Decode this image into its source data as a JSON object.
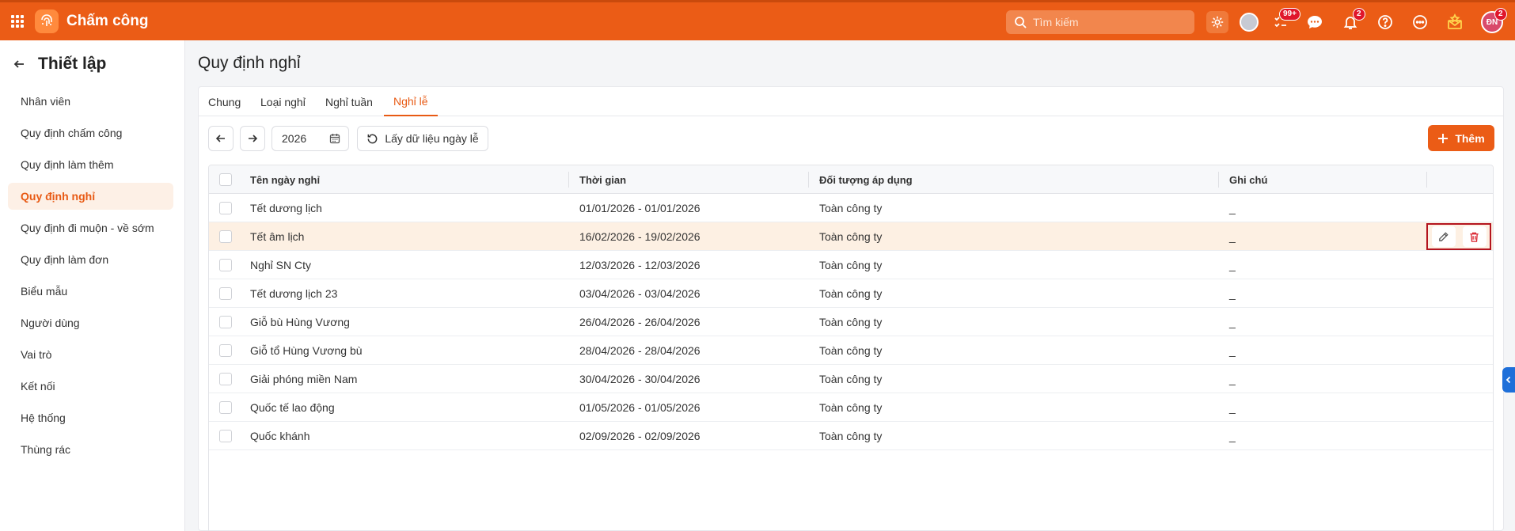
{
  "app": {
    "title": "Chấm công"
  },
  "topbar": {
    "search_placeholder": "Tìm kiếm",
    "tasks_badge": "99+",
    "notifications_badge": "2",
    "avatar_badge": "2",
    "avatar_initials": "ĐN"
  },
  "sidebar": {
    "title": "Thiết lập",
    "items": [
      {
        "label": "Nhân viên"
      },
      {
        "label": "Quy định chấm công"
      },
      {
        "label": "Quy định làm thêm"
      },
      {
        "label": "Quy định nghỉ"
      },
      {
        "label": "Quy định đi muộn - về sớm"
      },
      {
        "label": "Quy định làm đơn"
      },
      {
        "label": "Biểu mẫu"
      },
      {
        "label": "Người dùng"
      },
      {
        "label": "Vai trò"
      },
      {
        "label": "Kết nối"
      },
      {
        "label": "Hệ thống"
      },
      {
        "label": "Thùng rác"
      }
    ],
    "active_item": "Quy định nghỉ"
  },
  "main": {
    "title": "Quy định nghỉ",
    "tabs": [
      {
        "label": "Chung"
      },
      {
        "label": "Loại nghỉ"
      },
      {
        "label": "Nghỉ tuần"
      },
      {
        "label": "Nghỉ lễ"
      }
    ],
    "active_tab": "Nghỉ lễ",
    "toolbar": {
      "year_value": "2026",
      "fetch_label": "Lấy dữ liệu ngày lễ",
      "add_label": "Thêm"
    },
    "table": {
      "columns": [
        "Tên ngày nghỉ",
        "Thời gian",
        "Đối tượng áp dụng",
        "Ghi chú"
      ],
      "rows": [
        {
          "name": "Tết dương lịch",
          "time": "01/01/2026 - 01/01/2026",
          "target": "Toàn công ty",
          "note": "_"
        },
        {
          "name": "Tết âm lịch",
          "time": "16/02/2026 - 19/02/2026",
          "target": "Toàn công ty",
          "note": "_"
        },
        {
          "name": "Nghỉ SN Cty",
          "time": "12/03/2026 - 12/03/2026",
          "target": "Toàn công ty",
          "note": "_"
        },
        {
          "name": "Tết dương lịch 23",
          "time": "03/04/2026 - 03/04/2026",
          "target": "Toàn công ty",
          "note": "_"
        },
        {
          "name": "Giỗ bù Hùng Vương",
          "time": "26/04/2026 - 26/04/2026",
          "target": "Toàn công ty",
          "note": "_"
        },
        {
          "name": "Giỗ tổ Hùng Vương bù",
          "time": "28/04/2026 - 28/04/2026",
          "target": "Toàn công ty",
          "note": "_"
        },
        {
          "name": "Giải phóng miền Nam",
          "time": "30/04/2026 - 30/04/2026",
          "target": "Toàn công ty",
          "note": "_"
        },
        {
          "name": "Quốc tế lao động",
          "time": "01/05/2026 - 01/05/2026",
          "target": "Toàn công ty",
          "note": "_"
        },
        {
          "name": "Quốc khánh",
          "time": "02/09/2026 - 02/09/2026",
          "target": "Toàn công ty",
          "note": "_"
        }
      ],
      "hovered_row": "Tết âm lịch"
    }
  },
  "colors": {
    "brand": "#eb5c16",
    "hover_row": "#fdf0e3",
    "highlight_border": "#b4141e"
  }
}
